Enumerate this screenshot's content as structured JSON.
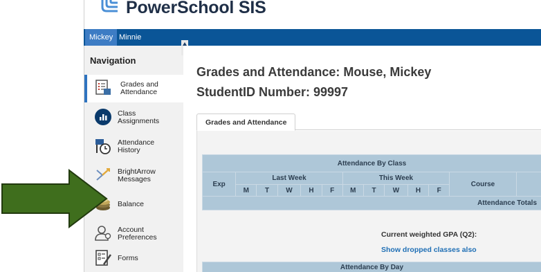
{
  "header": {
    "app_title": "PowerSchool SIS"
  },
  "students": {
    "tabs": [
      "Mickey",
      "Minnie"
    ],
    "selected": "Mickey"
  },
  "navigation": {
    "title": "Navigation",
    "items": [
      {
        "line1": "Grades and",
        "line2": "Attendance",
        "icon": "grades-attendance-icon",
        "active": true
      },
      {
        "line1": "Class",
        "line2": "Assignments",
        "icon": "class-assignments-icon",
        "active": false
      },
      {
        "line1": "Attendance",
        "line2": "History",
        "icon": "attendance-history-icon",
        "active": false
      },
      {
        "line1": "BrightArrow",
        "line2": "Messages",
        "icon": "brightarrow-icon",
        "active": false
      },
      {
        "line1": "Balance",
        "line2": "",
        "icon": "coins-icon",
        "active": false
      },
      {
        "line1": "Account",
        "line2": "Preferences",
        "icon": "account-icon",
        "active": false
      },
      {
        "line1": "Forms",
        "line2": "",
        "icon": "forms-icon",
        "active": false
      }
    ]
  },
  "main": {
    "title": "Grades and Attendance: Mouse, Mickey",
    "student_id": "StudentID Number: 99997",
    "tab_label": "Grades and Attendance",
    "table": {
      "title": "Attendance By Class",
      "exp": "Exp",
      "last_week": "Last Week",
      "this_week": "This Week",
      "days": [
        "M",
        "T",
        "W",
        "H",
        "F"
      ],
      "course": "Course",
      "totals": "Attendance Totals"
    },
    "gpa_label": "Current weighted GPA (Q2):",
    "dropped_link": "Show dropped classes also",
    "by_day_header": "Attendance By Day"
  },
  "colors": {
    "nav_bar": "#0a5597",
    "table_header": "#aec7d8",
    "arrow": "#3f6e1d",
    "link": "#1f6fb5"
  }
}
